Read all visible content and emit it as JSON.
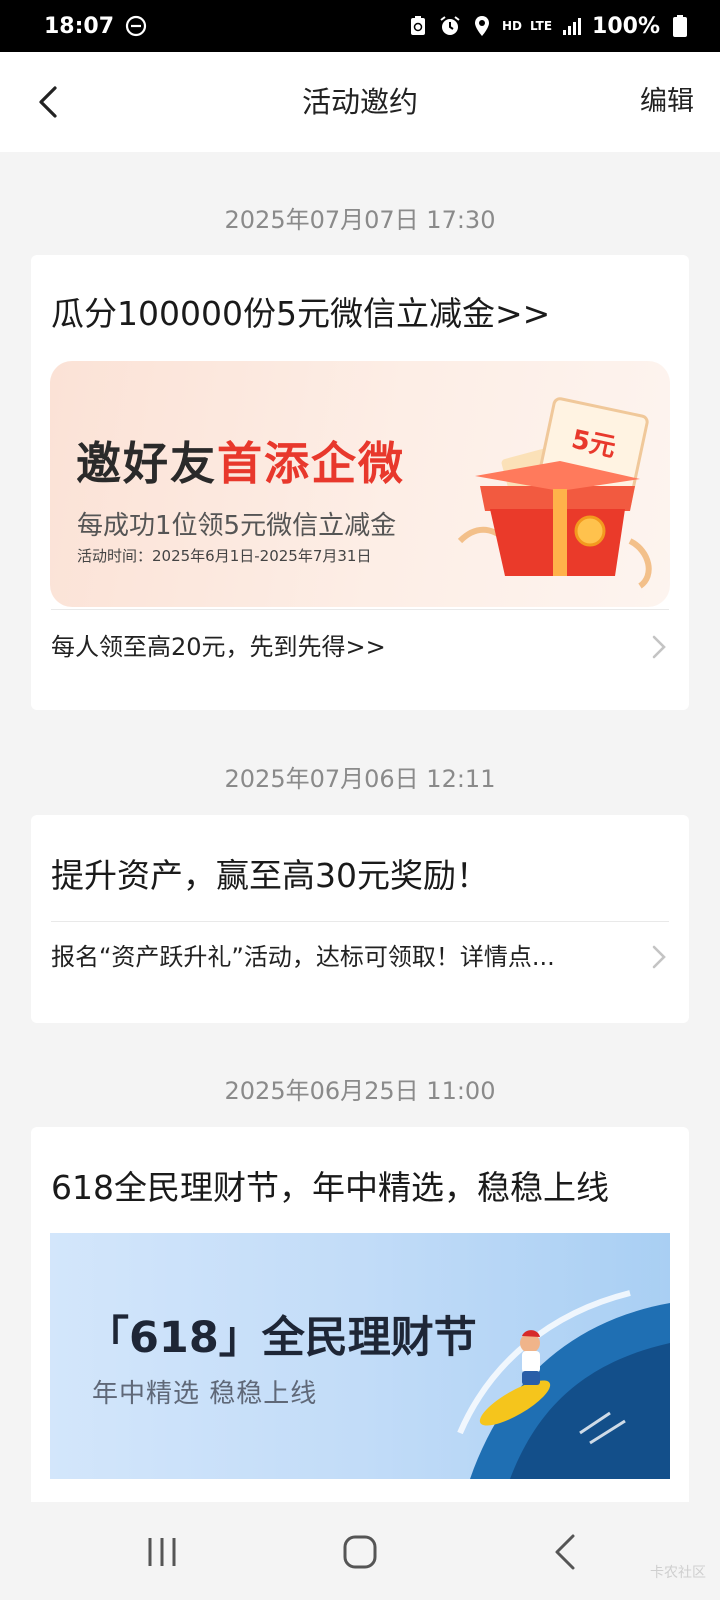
{
  "status_bar": {
    "time": "18:07",
    "network": "LTE",
    "hd": "HD",
    "battery": "100%"
  },
  "header": {
    "title": "活动邀约",
    "edit_label": "编辑"
  },
  "messages": [
    {
      "date": "2025年07月07日 17:30",
      "title": "瓜分100000份5元微信立减金>>",
      "banner": {
        "headline_dark": "邀好友",
        "headline_red": "首添企微",
        "subline": "每成功1位领5元微信立减金",
        "period": "活动时间：2025年6月1日-2025年7月31日",
        "coupon_label": "5元"
      },
      "link": "每人领至高20元，先到先得>>"
    },
    {
      "date": "2025年07月06日 12:11",
      "title": "提升资产，赢至高30元奖励！",
      "link": "报名“资产跃升礼”活动，达标可领取！详情点..."
    },
    {
      "date": "2025年06月25日 11:00",
      "title": "618全民理财节，年中精选，稳稳上线",
      "banner": {
        "headline": "「618」全民理财节",
        "subline": "年中精选 稳稳上线"
      }
    }
  ],
  "watermark": "卡农社区",
  "colors": {
    "accent_red": "#e8382c",
    "page_bg": "#f4f4f4"
  }
}
